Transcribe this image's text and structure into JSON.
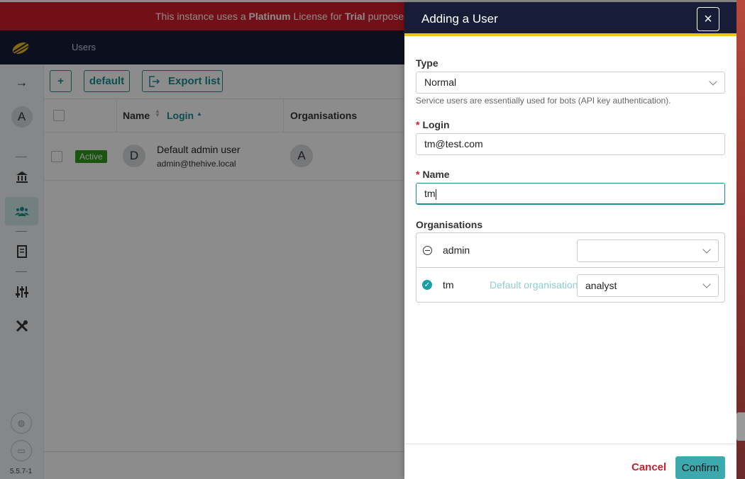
{
  "banner": {
    "pre": "This instance uses a ",
    "license": "Platinum",
    "mid": " License for ",
    "purpose": "Trial",
    "post": " purpose, a"
  },
  "navbar": {
    "section": "Users"
  },
  "sidebar": {
    "version": "5.5.7-1",
    "avatar_letter": "A",
    "items": [
      "expand-arrow",
      "organisations",
      "users",
      "knowledge-base",
      "settings",
      "tools"
    ]
  },
  "toolbar": {
    "add_label": "+",
    "filter_label": "default",
    "export_label": "Export list"
  },
  "table": {
    "columns": [
      "Name",
      "Login",
      "Organisations"
    ],
    "rows": [
      {
        "status": "Active",
        "initial": "D",
        "name": "Default admin user",
        "login": "admin@thehive.local",
        "org_initial": "A"
      }
    ]
  },
  "drawer": {
    "title": "Adding a User",
    "close_symbol": "×",
    "type_label": "Type",
    "type_value": "Normal",
    "type_hint": "Service users are essentially used for bots (API key authentication).",
    "login_label": "Login",
    "login_value": "tm@test.com",
    "name_label": "Name",
    "name_value": "tm",
    "required_mark": "*",
    "orgs_label": "Organisations",
    "orgs": [
      {
        "name": "admin",
        "default_text": "",
        "profile": ""
      },
      {
        "name": "tm",
        "default_text": "Default organisation",
        "profile": "analyst"
      }
    ],
    "cancel_label": "Cancel",
    "confirm_label": "Confirm"
  },
  "colors": {
    "accent": "#1a8d92",
    "banner": "#d01c2b",
    "navbar": "#171d36",
    "active_badge": "#2e9b1b",
    "header_underline": "#f1c21b"
  }
}
